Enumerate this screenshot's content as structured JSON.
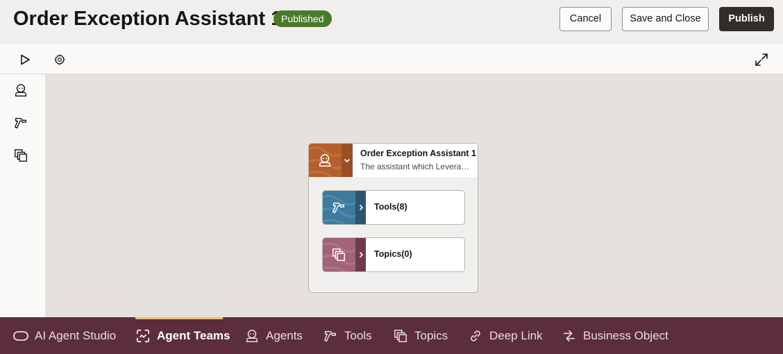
{
  "header": {
    "title": "Order Exception Assistant 1",
    "status_badge": "Published",
    "cancel_label": "Cancel",
    "save_close_label": "Save and Close",
    "publish_label": "Publish"
  },
  "toolbar": {
    "icons": [
      "play-icon",
      "gear-icon",
      "expand-icon"
    ]
  },
  "sidebar": {
    "icons": [
      "agent-icon",
      "tool-hammer-icon",
      "topics-icon"
    ]
  },
  "canvas": {
    "agent_card": {
      "title": "Order Exception Assistant 1",
      "subtitle": "The assistant which Leverages the tools to manage order exceptions",
      "icon": "agent-icon"
    },
    "nodes": [
      {
        "label": "Tools(8)",
        "icon": "tool-hammer-icon",
        "color": "#3f7a9c"
      },
      {
        "label": "Topics(0)",
        "icon": "topics-icon",
        "color": "#a0637a"
      }
    ]
  },
  "bottom_nav": {
    "items": [
      {
        "label": "AI Agent Studio",
        "icon": "pill-icon",
        "active": false
      },
      {
        "label": "Agent Teams",
        "icon": "agent-teams-icon",
        "active": true
      },
      {
        "label": "Agents",
        "icon": "agent-icon",
        "active": false
      },
      {
        "label": "Tools",
        "icon": "tool-hammer-icon",
        "active": false
      },
      {
        "label": "Topics",
        "icon": "topics-icon",
        "active": false
      },
      {
        "label": "Deep Link",
        "icon": "link-icon",
        "active": false
      },
      {
        "label": "Business Object",
        "icon": "business-object-icon",
        "active": false
      }
    ]
  },
  "colors": {
    "brand_nav": "#5c2d3a",
    "agent_card": "#b3602e",
    "tools_card": "#3f7a9c",
    "topics_card": "#a0637a",
    "published_badge": "#4b7a2c",
    "active_indicator": "#e6c07a"
  }
}
